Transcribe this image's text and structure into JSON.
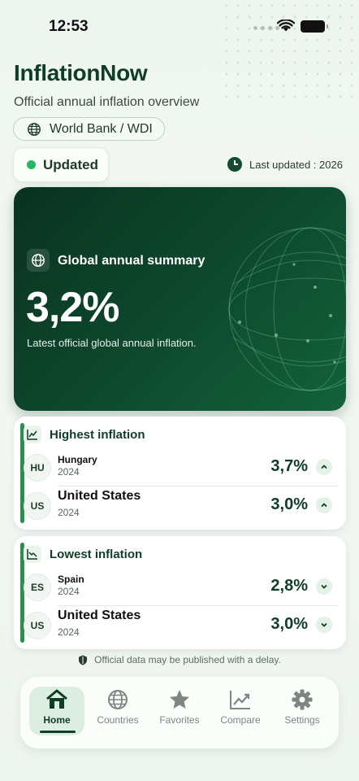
{
  "status_bar": {
    "time": "12:53"
  },
  "header": {
    "app_title": "InflationNow",
    "subtitle": "Official annual inflation overview",
    "source": "World Bank / WDI",
    "update_status": "Updated",
    "last_updated": "Last updated : 2026"
  },
  "summary": {
    "title": "Global annual summary",
    "value": "3,2%",
    "note": "Latest official global annual inflation."
  },
  "highest": {
    "title": "Highest inflation",
    "rows": [
      {
        "code": "HU",
        "country": "Hungary",
        "year": "2024",
        "value": "3,7%"
      },
      {
        "code": "US",
        "country": "United States",
        "year": "2024",
        "value": "3,0%"
      }
    ]
  },
  "lowest": {
    "title": "Lowest inflation",
    "rows": [
      {
        "code": "ES",
        "country": "Spain",
        "year": "2024",
        "value": "2,8%"
      },
      {
        "code": "US",
        "country": "United States",
        "year": "2024",
        "value": "3,0%"
      }
    ]
  },
  "disclaimer": "Official data may be published with a delay.",
  "tabs": [
    {
      "label": "Home",
      "icon": "home-icon",
      "active": true
    },
    {
      "label": "Countries",
      "icon": "globe-icon",
      "active": false
    },
    {
      "label": "Favorites",
      "icon": "star-icon",
      "active": false
    },
    {
      "label": "Compare",
      "icon": "trend-icon",
      "active": false
    },
    {
      "label": "Settings",
      "icon": "gear-icon",
      "active": false
    }
  ],
  "colors": {
    "primary": "#0f3d28",
    "accent": "#26b765",
    "hero_bg": "#0e4a2e"
  }
}
